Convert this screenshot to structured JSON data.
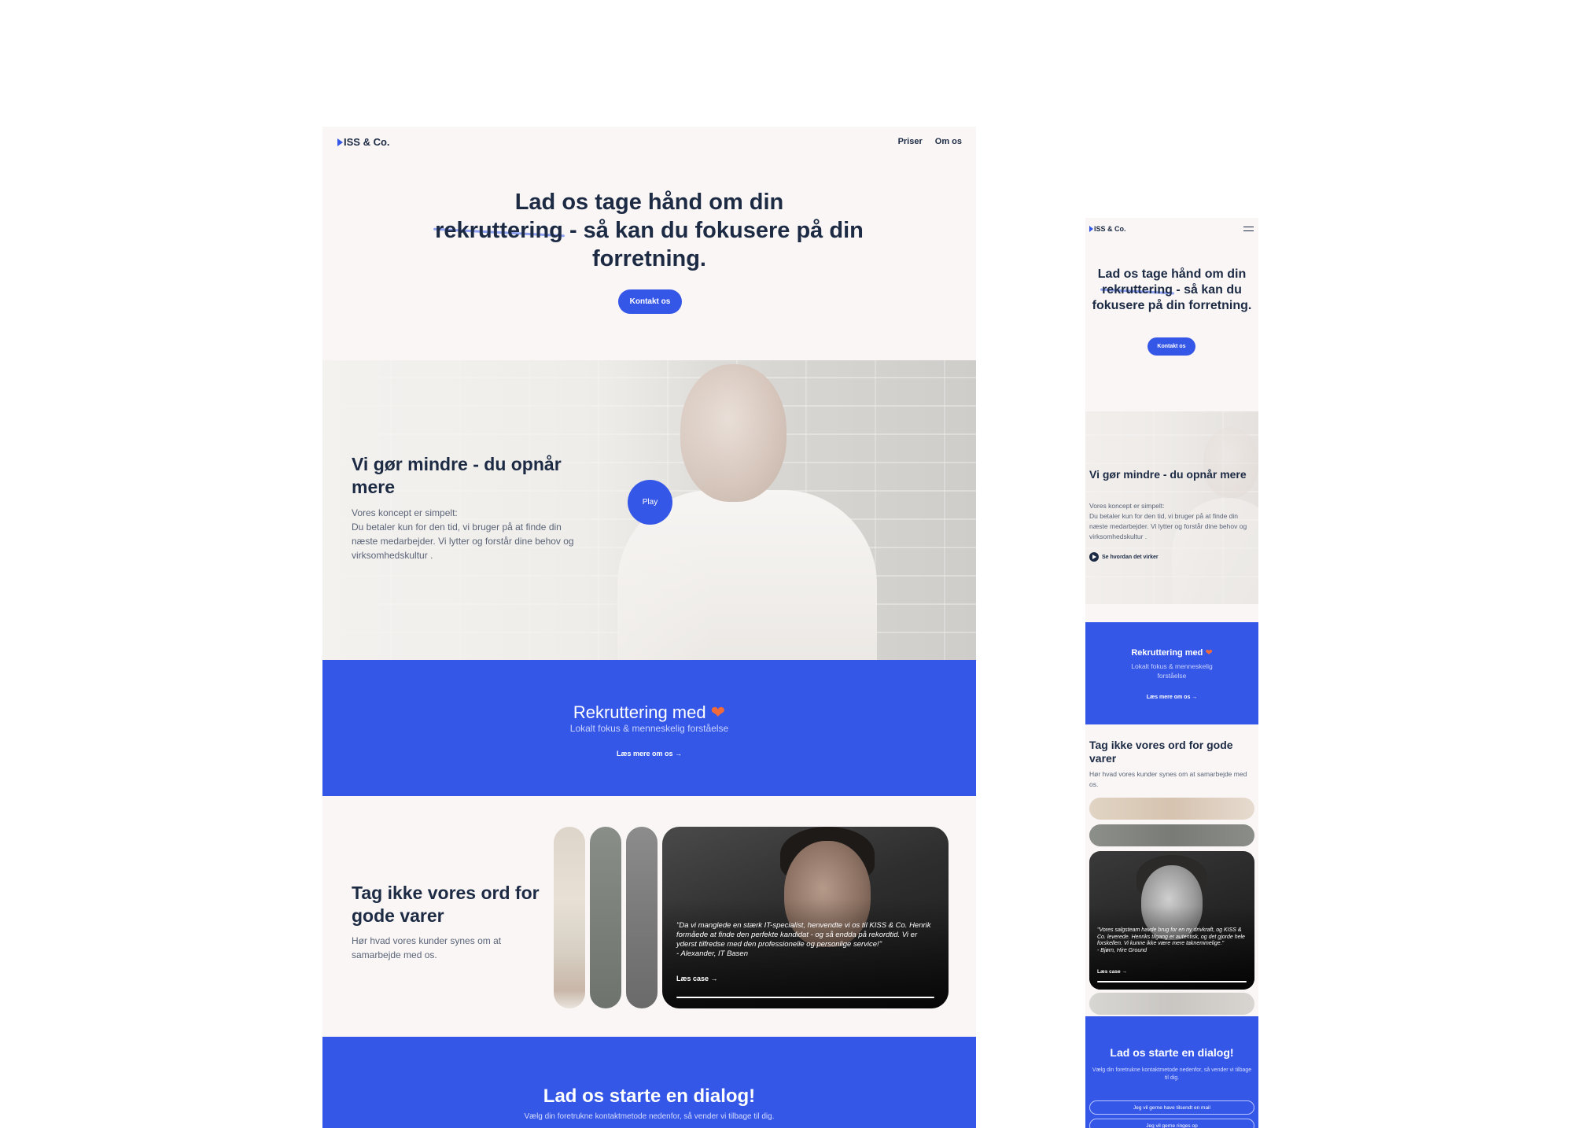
{
  "brand": {
    "logo_text": "ISS & Co.",
    "accent_color": "#3557e8",
    "text_color": "#1c2a44",
    "heart_color": "#f26a3a"
  },
  "nav": {
    "links": [
      "Priser",
      "Om os"
    ],
    "menu_icon": "hamburger-menu-icon"
  },
  "hero": {
    "title_before": "Lad os tage hånd om din",
    "title_highlight": "rekruttering",
    "title_after": "- så kan du fokusere på din forretning.",
    "cta_label": "Kontakt os"
  },
  "video_section": {
    "title": "Vi gør mindre - du opnår mere",
    "intro": "Vores koncept er simpelt:",
    "body": "Du betaler kun for den tid, vi bruger på at finde din næste medarbejder. Vi lytter og forstår dine behov og virksomhedskultur .",
    "play_label": "Play",
    "how_link": "Se hvordan det virker"
  },
  "about_band": {
    "title": "Rekruttering med",
    "heart": "❤",
    "subtitle": "Lokalt fokus & menneskelig forståelse",
    "link": "Læs mere om os →"
  },
  "testimonials": {
    "title": "Tag ikke vores ord for gode varer",
    "subtitle": "Hør hvad vores kunder synes om at samarbejde med os.",
    "desktop_quote": "\"Da vi manglede en stærk IT-specialist, henvendte vi os til KISS & Co. Henrik formåede at finde den perfekte kandidat - og så endda på rekordtid. Vi er yderst tilfredse med den professionelle og personlige service!\"",
    "desktop_author": "- Alexander, IT Basen",
    "mobile_quote": "\"Vores salgsteam havde brug for en ny drivkraft, og KISS & Co. leverede. Henriks tilgang er autentisk, og det gjorde hele forskellen. Vi kunne ikke være mere taknemmelige.\"",
    "mobile_author": "- Bjørn, Hire Ground",
    "case_link": "Læs case →"
  },
  "contact_band": {
    "title": "Lad os starte en dialog!",
    "subtitle": "Vælg din foretrukne kontaktmetode nedenfor, så vender vi tilbage til dig.",
    "buttons": [
      "Jeg vil gerne have tilsendt en mail",
      "Jeg vil gerne ringes op"
    ]
  }
}
